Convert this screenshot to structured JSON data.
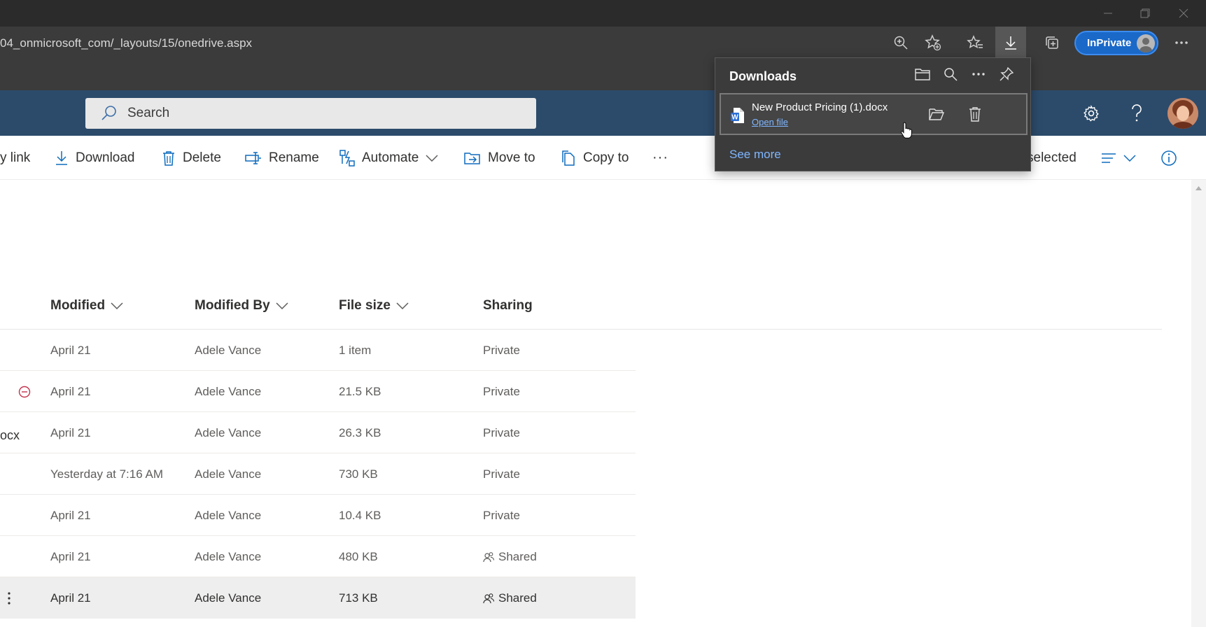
{
  "browser": {
    "url": "04_onmicrosoft_com/_layouts/15/onedrive.aspx",
    "inprivate_label": "InPrivate"
  },
  "suite": {
    "search_placeholder": "Search"
  },
  "commands": {
    "copy_link": "y link",
    "download": "Download",
    "delete": "Delete",
    "rename": "Rename",
    "automate": "Automate",
    "move_to": "Move to",
    "copy_to": "Copy to",
    "more": "···",
    "selected": "selected"
  },
  "columns": {
    "modified": "Modified",
    "modified_by": "Modified By",
    "file_size": "File size",
    "sharing": "Sharing"
  },
  "rows": [
    {
      "name_fragment": "",
      "modified": "April 21",
      "modified_by": "Adele Vance",
      "size": "1 item",
      "sharing": "Private",
      "shared": false
    },
    {
      "name_fragment": "",
      "modified": "April 21",
      "modified_by": "Adele Vance",
      "size": "21.5 KB",
      "sharing": "Private",
      "shared": false,
      "status_icon": "blocked-circle-icon"
    },
    {
      "name_fragment": "ocx",
      "modified": "April 21",
      "modified_by": "Adele Vance",
      "size": "26.3 KB",
      "sharing": "Private",
      "shared": false
    },
    {
      "name_fragment": "",
      "modified": "Yesterday at 7:16 AM",
      "modified_by": "Adele Vance",
      "size": "730 KB",
      "sharing": "Private",
      "shared": false
    },
    {
      "name_fragment": "",
      "modified": "April 21",
      "modified_by": "Adele Vance",
      "size": "10.4 KB",
      "sharing": "Private",
      "shared": false
    },
    {
      "name_fragment": "",
      "modified": "April 21",
      "modified_by": "Adele Vance",
      "size": "480 KB",
      "sharing": "Shared",
      "shared": true
    },
    {
      "name_fragment": "",
      "modified": "April 21",
      "modified_by": "Adele Vance",
      "size": "713 KB",
      "sharing": "Shared",
      "shared": true,
      "selected": true
    }
  ],
  "downloads": {
    "title": "Downloads",
    "item_filename": "New Product Pricing (1).docx",
    "item_action": "Open file",
    "see_more": "See more"
  },
  "colors": {
    "suite_bar": "#2c4b6b",
    "accent": "#1a69c9",
    "link": "#7fb6ff",
    "command_icon": "#0f6cbd"
  }
}
